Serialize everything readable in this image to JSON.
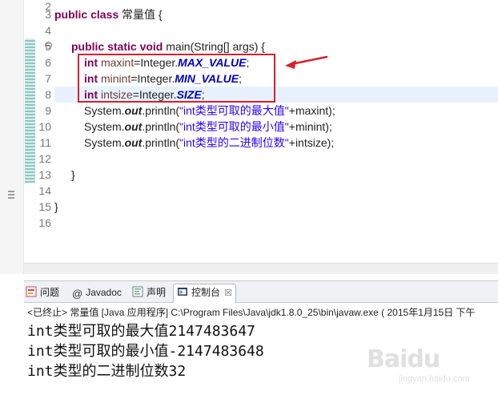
{
  "editor": {
    "line_numbers": [
      "2",
      "3",
      "4",
      "5",
      "6",
      "7",
      "8",
      "9",
      "10",
      "11",
      "12",
      "13",
      "14",
      "15",
      "16"
    ],
    "line3": {
      "kw": "public class",
      "name": " 常量值 {"
    },
    "line5": {
      "kw": "public static void",
      "rest": " main(String[] args) {"
    },
    "line6": {
      "kw": "int",
      "var": " maxint",
      "rest": "=Integer.",
      "fld": "MAX_VALUE",
      "end": ";"
    },
    "line7": {
      "kw": "int",
      "var": " minint",
      "rest": "=Integer.",
      "fld": "MIN_VALUE",
      "end": ";"
    },
    "line8": {
      "kw": "int",
      "var": " intsize",
      "rest": "=Integer.",
      "fld": "SIZE",
      "end": ";"
    },
    "line9": {
      "pre": "System.",
      "out": "out",
      "call": ".println(",
      "str": "\"int类型可取的最大值\"",
      "tail": "+maxint);"
    },
    "line10": {
      "pre": "System.",
      "out": "out",
      "call": ".println(",
      "str": "\"int类型可取的最小值\"",
      "tail": "+minint);"
    },
    "line11": {
      "pre": "System.",
      "out": "out",
      "call": ".println(",
      "str": "\"int类型的二进制位数\"",
      "tail": "+intsize);"
    },
    "line13": "}",
    "line15": "}"
  },
  "console": {
    "tabs": [
      {
        "label": "问题",
        "icon": "problems-icon"
      },
      {
        "label": "Javadoc",
        "icon": "at-icon"
      },
      {
        "label": "声明",
        "icon": "declaration-icon"
      },
      {
        "label": "控制台",
        "icon": "console-icon",
        "active": true
      }
    ],
    "close_label": "☒",
    "description": "<已终止> 常量值 [Java 应用程序] C:\\Program Files\\Java\\jdk1.8.0_25\\bin\\javaw.exe ( 2015年1月15日 下午",
    "output": [
      "int类型可取的最大值2147483647",
      "int类型可取的最小值-2147483648",
      "int类型的二进制位数32"
    ]
  },
  "colors": {
    "annotation_red": "#d8202a",
    "keyword": "#7f0055",
    "string": "#2a00ff",
    "static_field": "#0000c0"
  },
  "watermark": {
    "brand": "Baidu",
    "sub": "jingyan.baidu.com"
  }
}
